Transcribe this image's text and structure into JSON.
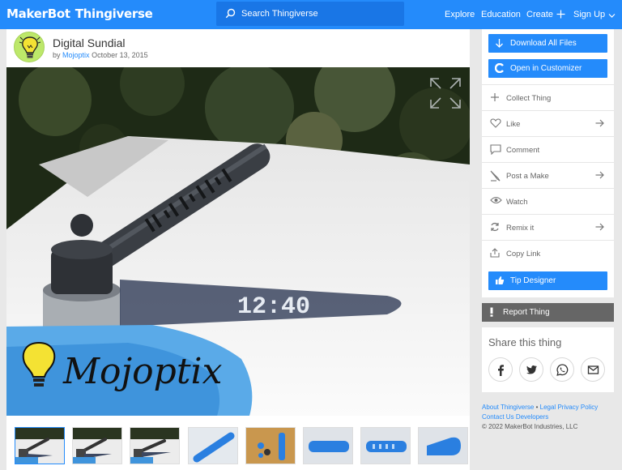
{
  "nav": {
    "logo_brand": "MakerBot",
    "logo_product": "Thingiverse",
    "search_placeholder": "Search Thingiverse",
    "links": {
      "explore": "Explore",
      "education": "Education",
      "create": "Create",
      "signup": "Sign Up"
    }
  },
  "thing": {
    "title": "Digital Sundial",
    "by": "by",
    "author": "Mojoptix",
    "date": "October 13, 2015"
  },
  "hero": {
    "logo_text": "Mojoptix",
    "shadow_time": "12:40"
  },
  "thumbnails": {
    "count": 8,
    "active_index": 0
  },
  "sidebar": {
    "download": "Download All Files",
    "customizer": "Open in Customizer",
    "actions": [
      {
        "label": "Collect Thing",
        "icon": "plus-icon",
        "arrow": false
      },
      {
        "label": "Like",
        "icon": "heart-icon",
        "arrow": true
      },
      {
        "label": "Comment",
        "icon": "comment-icon",
        "arrow": false
      },
      {
        "label": "Post a Make",
        "icon": "pencil-icon",
        "arrow": true
      },
      {
        "label": "Watch",
        "icon": "eye-icon",
        "arrow": false
      },
      {
        "label": "Remix it",
        "icon": "remix-icon",
        "arrow": true
      },
      {
        "label": "Copy Link",
        "icon": "share-icon",
        "arrow": false
      }
    ],
    "tip": "Tip Designer",
    "report": "Report Thing"
  },
  "share": {
    "title": "Share this thing",
    "networks": [
      "facebook-icon",
      "twitter-icon",
      "whatsapp-icon",
      "email-icon"
    ]
  },
  "footer": {
    "about": "About Thingiverse",
    "legal": "Legal",
    "privacy": "Privacy Policy",
    "contact": "Contact Us",
    "developers": "Developers",
    "copyright": "© 2022 MakerBot Industries, LLC"
  },
  "colors": {
    "brand_blue": "#248bfb",
    "report_gray": "#666666"
  }
}
